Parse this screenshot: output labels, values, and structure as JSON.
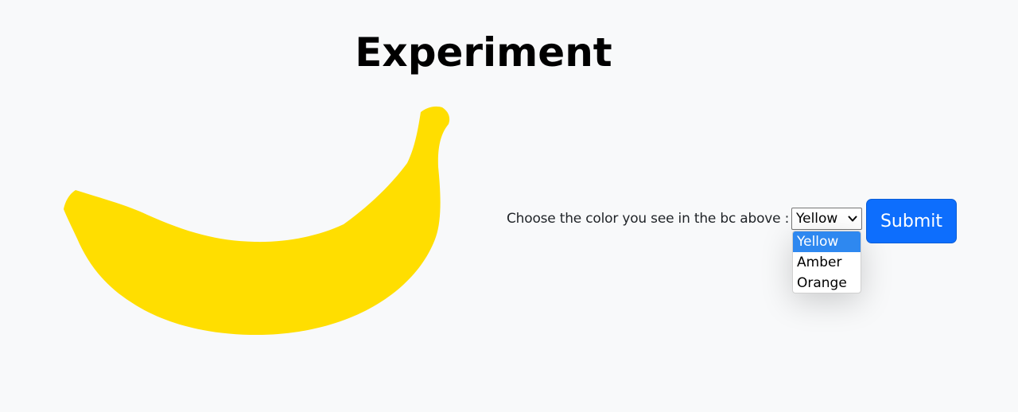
{
  "page": {
    "title": "Experiment"
  },
  "banana": {
    "color": "#ffde00",
    "icon": "banana-icon"
  },
  "form": {
    "question_label": "Choose the color you see in the bc above :",
    "select_value": "Yellow",
    "options": [
      "Yellow",
      "Amber",
      "Orange"
    ],
    "selected_option": "Yellow",
    "submit_label": "Submit"
  },
  "colors": {
    "background": "#f8f9fa",
    "primary": "#0d6efd",
    "option_highlight": "#2e88f0"
  }
}
